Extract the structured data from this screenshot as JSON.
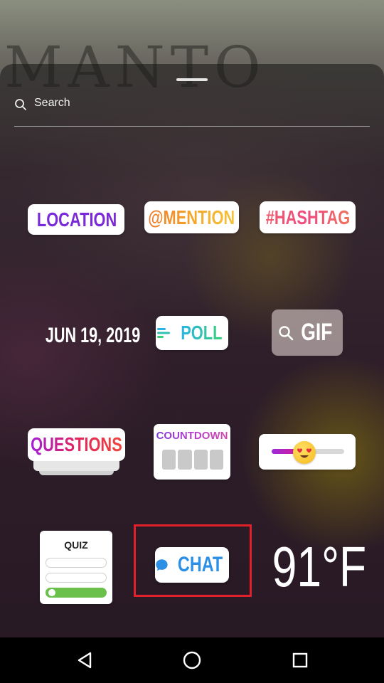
{
  "background": {
    "letters": "MANTO"
  },
  "search": {
    "placeholder": "Search"
  },
  "stickers": {
    "location": "LOCATION",
    "mention": "@MENTION",
    "hashtag": "#HASHTAG",
    "date": "JUN 19, 2019",
    "poll": "POLL",
    "gif": "GIF",
    "questions": "QUESTIONS",
    "countdown": "COUNTDOWN",
    "slider_level": 0.45,
    "quiz": "QUIZ",
    "chat": "CHAT",
    "temperature": "91°F"
  },
  "highlight_color": "#e0202a",
  "icons": {
    "search": "search-icon",
    "location": "location-pin-icon",
    "poll": "poll-lines-icon",
    "gif": "search-icon",
    "chat": "chat-bubble-icon",
    "slider": "heart-eyes-emoji-icon",
    "nav_back": "back-triangle-icon",
    "nav_home": "home-circle-icon",
    "nav_recent": "recents-square-icon"
  }
}
